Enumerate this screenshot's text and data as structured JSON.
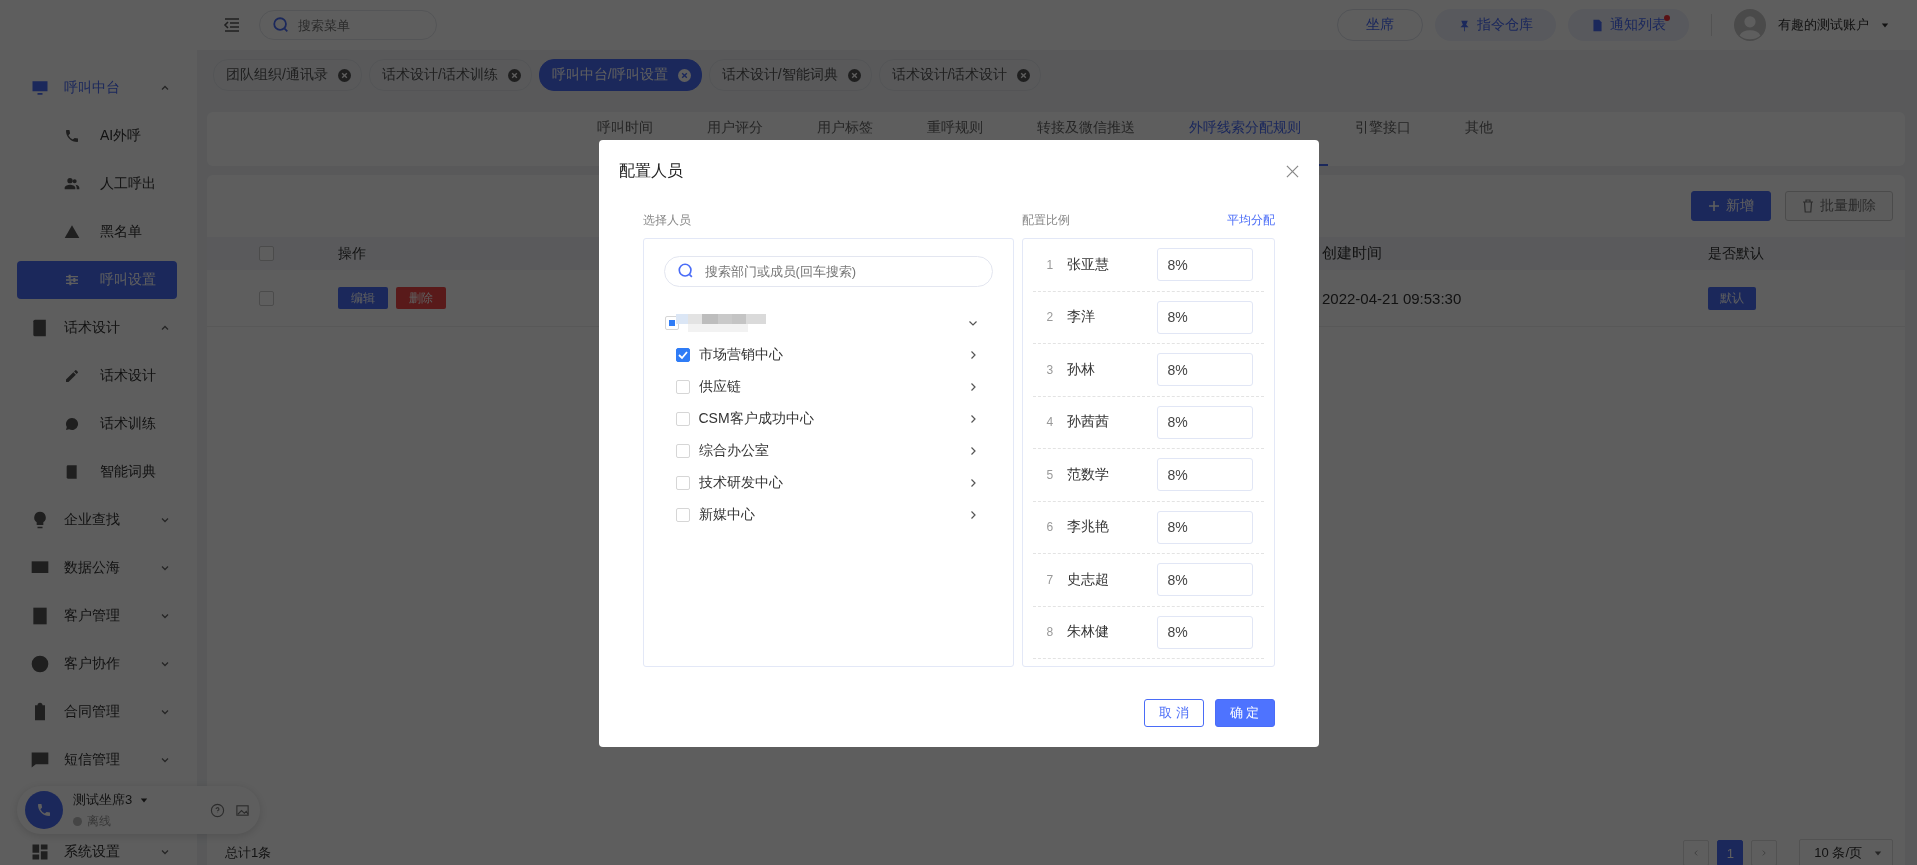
{
  "topbar": {
    "search": {
      "placeholder": "搜索菜单"
    },
    "buttons": [
      {
        "label": "坐席",
        "kind": "plain",
        "unread": false
      },
      {
        "label": "指令仓库",
        "kind": "pin",
        "unread": false
      },
      {
        "label": "通知列表",
        "kind": "doc",
        "unread": true
      }
    ],
    "user": {
      "name": "有趣的测试账户"
    }
  },
  "sidebar": {
    "items": [
      {
        "label": "呼叫中台",
        "expanded": true,
        "children": [
          {
            "label": "AI外呼",
            "selected": false
          },
          {
            "label": "人工呼出",
            "selected": false
          },
          {
            "label": "黑名单",
            "selected": false
          },
          {
            "label": "呼叫设置",
            "selected": true
          }
        ]
      },
      {
        "label": "话术设计",
        "expanded": true,
        "children": [
          {
            "label": "话术设计",
            "selected": false
          },
          {
            "label": "话术训练",
            "selected": false
          },
          {
            "label": "智能词典",
            "selected": false
          }
        ]
      },
      {
        "label": "企业查找",
        "expanded": false
      },
      {
        "label": "数据公海",
        "expanded": false
      },
      {
        "label": "客户管理",
        "expanded": false
      },
      {
        "label": "客户协作",
        "expanded": false
      },
      {
        "label": "合同管理",
        "expanded": false
      },
      {
        "label": "短信管理",
        "expanded": false
      },
      {
        "label": "系统设置",
        "expanded": false
      }
    ]
  },
  "phone_widget": {
    "name": "测试坐席3",
    "status": "离线",
    "online": false
  },
  "tags": [
    {
      "label": "团队组织/通讯录",
      "selected": false
    },
    {
      "label": "话术设计/话术训练",
      "selected": false
    },
    {
      "label": "呼叫中台/呼叫设置",
      "selected": true
    },
    {
      "label": "话术设计/智能词典",
      "selected": false
    },
    {
      "label": "话术设计/话术设计",
      "selected": false
    }
  ],
  "tabs": [
    {
      "label": "呼叫时间",
      "selected": false
    },
    {
      "label": "用户评分",
      "selected": false
    },
    {
      "label": "用户标签",
      "selected": false
    },
    {
      "label": "重呼规则",
      "selected": false
    },
    {
      "label": "转接及微信推送",
      "selected": false
    },
    {
      "label": "外呼线索分配规则",
      "selected": true
    },
    {
      "label": "引擎接口",
      "selected": false
    },
    {
      "label": "其他",
      "selected": false
    }
  ],
  "toolbar": [
    {
      "label": "新增",
      "kind": "add",
      "disabled": false
    },
    {
      "label": "批量删除",
      "kind": "delete",
      "disabled": true
    }
  ],
  "table": {
    "all_checked": false,
    "columns": [
      "操作",
      "创建时间",
      "是否默认"
    ],
    "rows": [
      {
        "checked": false,
        "actions": [
          {
            "label": "编辑",
            "kind": "edit"
          },
          {
            "label": "删除",
            "kind": "delete"
          }
        ],
        "created": "2022-04-21 09:53:30",
        "default": "默认"
      }
    ]
  },
  "footer": {
    "total": "总计1条",
    "pages": [
      {
        "label": "1",
        "selected": true
      }
    ],
    "page_size": "10 条/页"
  },
  "dialog": {
    "title": "配置人员",
    "left_label": "选择人员",
    "search": {
      "placeholder": "搜索部门或成员(回车搜索)"
    },
    "tree": {
      "redacted": true,
      "indeterminate": true,
      "expanded": true,
      "children": [
        {
          "label": "市场营销中心",
          "checked": true
        },
        {
          "label": "供应链",
          "checked": false
        },
        {
          "label": "CSM客户成功中心",
          "checked": false
        },
        {
          "label": "综合办公室",
          "checked": false
        },
        {
          "label": "技术研发中心",
          "checked": false
        },
        {
          "label": "新媒中心",
          "checked": false
        }
      ]
    },
    "right_label": "配置比例",
    "link": "平均分配",
    "people": [
      {
        "index": "1",
        "name": "张亚慧",
        "ratio": "8%"
      },
      {
        "index": "2",
        "name": "李洋",
        "ratio": "8%"
      },
      {
        "index": "3",
        "name": "孙林",
        "ratio": "8%"
      },
      {
        "index": "4",
        "name": "孙茜茜",
        "ratio": "8%"
      },
      {
        "index": "5",
        "name": "范数学",
        "ratio": "8%"
      },
      {
        "index": "6",
        "name": "李兆艳",
        "ratio": "8%"
      },
      {
        "index": "7",
        "name": "史志超",
        "ratio": "8%"
      },
      {
        "index": "8",
        "name": "朱林健",
        "ratio": "8%"
      }
    ],
    "buttons": [
      {
        "label": "取 消",
        "kind": "cancel"
      },
      {
        "label": "确 定",
        "kind": "ok"
      }
    ]
  }
}
